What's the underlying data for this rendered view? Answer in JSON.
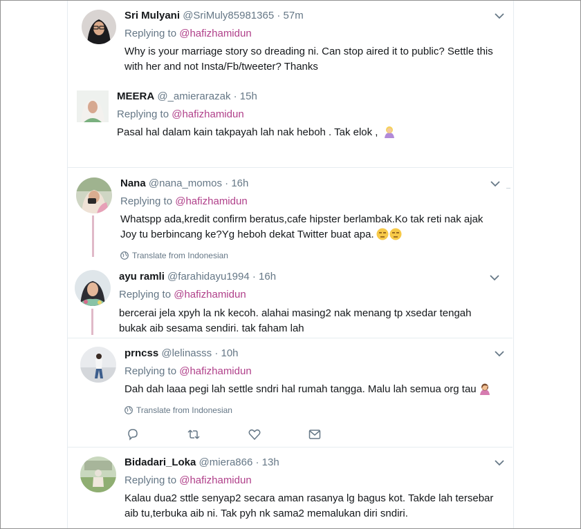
{
  "colors": {
    "mention": "#b0408a",
    "secondary": "#657786",
    "thread": "#e0b9c8",
    "border": "#e6ecf0"
  },
  "tweets": [
    {
      "name": "Sri Mulyani",
      "handle": "@SriMuly85981365",
      "time": "· 57m",
      "replying_label": "Replying to",
      "mention": "@hafizhamidun",
      "lines": [
        "Why is your marriage story so dreading ni. Can stop aired it to public? Settle this",
        "with her and not Insta/Fb/tweeter? Thanks"
      ]
    },
    {
      "name": "MEERA",
      "handle": "@_amierarazak",
      "time": "· 15h",
      "replying_label": "Replying to",
      "mention": "@hafizhamidun",
      "lines": [
        "Pasal hal dalam kain takpayah lah nak heboh . Tak elok ,"
      ],
      "emoji": "person-blond-emoji"
    },
    {
      "name": "Nana",
      "handle": "@nana_momos",
      "time": "· 16h",
      "replying_label": "Replying to",
      "mention": "@hafizhamidun",
      "lines": [
        "Whatspp ada,kredit confirm beratus,cafe hipster berlambak.Ko tak reti nak ajak",
        "Joy tu berbincang ke?Yg heboh dekat Twitter buat apa."
      ],
      "emoji": "unamused-face-emoji",
      "translate": "Translate from Indonesian"
    },
    {
      "name": "ayu ramli",
      "handle": "@farahidayu1994",
      "time": "· 16h",
      "replying_label": "Replying to",
      "mention": "@hafizhamidun",
      "lines": [
        "bercerai jela xpyh la nk kecoh. alahai masing2 nak menang tp xsedar tengah",
        "bukak aib sesama sendiri. tak faham lah"
      ]
    },
    {
      "name": "prncss",
      "handle": "@lelinasss",
      "time": "· 10h",
      "replying_label": "Replying to",
      "mention": "@hafizhamidun",
      "lines": [
        "Dah dah laaa pegi lah settle sndri hal rumah tangga. Malu lah semua org tau"
      ],
      "emoji": "person-facepalming-emoji",
      "translate": "Translate from Indonesian",
      "actions": [
        "reply-icon",
        "retweet-icon",
        "like-icon",
        "message-icon"
      ]
    },
    {
      "name": "Bidadari_Loka",
      "handle": "@miera866",
      "time": "· 13h",
      "replying_label": "Replying to",
      "mention": "@hafizhamidun",
      "lines": [
        "Kalau dua2 sttle senyap2 secara aman rasanya lg bagus kot. Takde lah tersebar",
        "aib tu,terbuka aib ni. Tak pyh nk sama2 memalukan diri sndiri."
      ]
    }
  ]
}
